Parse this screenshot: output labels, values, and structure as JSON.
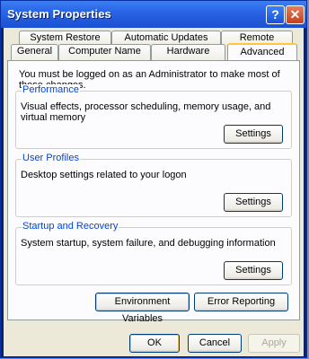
{
  "window": {
    "title": "System Properties",
    "help_glyph": "?",
    "close_glyph": "✕"
  },
  "tabs": {
    "row1": [
      "System Restore",
      "Automatic Updates",
      "Remote"
    ],
    "row2": [
      "General",
      "Computer Name",
      "Hardware",
      "Advanced"
    ],
    "active": "Advanced"
  },
  "advanced": {
    "admin_note": "You must be logged on as an Administrator to make most of these changes.",
    "performance": {
      "title": "Performance",
      "description": "Visual effects, processor scheduling, memory usage, and virtual memory",
      "button": "Settings"
    },
    "user_profiles": {
      "title": "User Profiles",
      "description": "Desktop settings related to your logon",
      "button": "Settings"
    },
    "startup_recovery": {
      "title": "Startup and Recovery",
      "description": "System startup, system failure, and debugging information",
      "button": "Settings"
    },
    "env_button": "Environment Variables",
    "error_button": "Error Reporting"
  },
  "footer": {
    "ok": "OK",
    "cancel": "Cancel",
    "apply": "Apply"
  },
  "colors": {
    "titlebar": "#2a64e6",
    "group_title": "#0046d5",
    "dialog_bg": "#ece9d8"
  }
}
